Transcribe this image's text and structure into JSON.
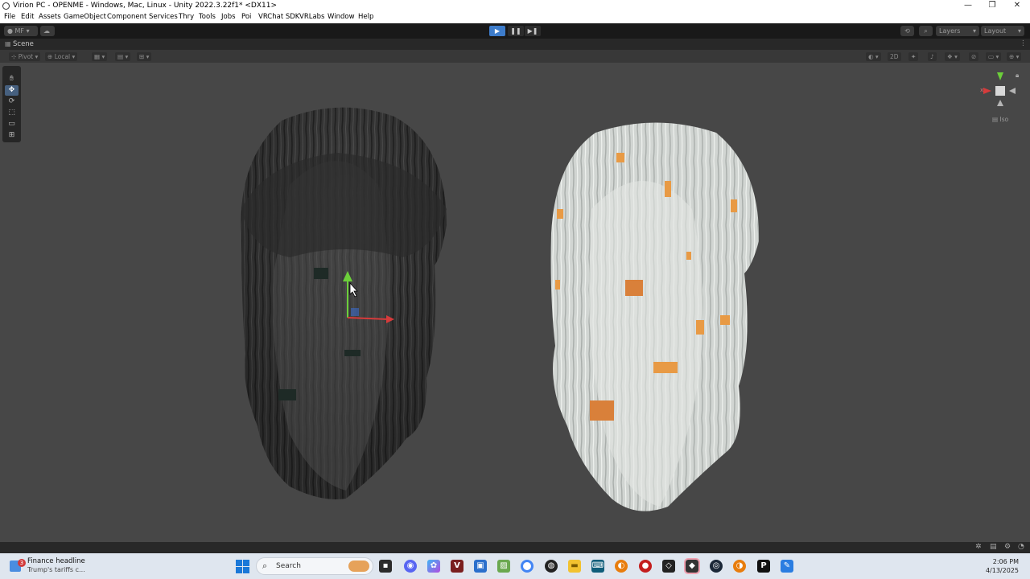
{
  "window": {
    "title": "Virion PC - OPENME - Windows, Mac, Linux - Unity 2022.3.22f1* <DX11>",
    "minimize": "—",
    "maximize": "❐",
    "close": "✕"
  },
  "menu": [
    "File",
    "Edit",
    "Assets",
    "GameObject",
    "Component",
    "Services",
    "Thry",
    "Tools",
    "Jobs",
    "Poi",
    "VRChat SDK",
    "VRLabs",
    "Window",
    "Help"
  ],
  "toolbar": {
    "account": "MF",
    "play": "▶",
    "pause": "❚❚",
    "step": "▶❚",
    "layers": "Layers",
    "layout": "Layout"
  },
  "scene": {
    "tab_label": "Scene",
    "pivot": "Pivot",
    "local": "Local",
    "mode_2d": "2D",
    "iso_label": "Iso",
    "gizmo_x": "x"
  },
  "tools": [
    "hand-tool",
    "move-tool",
    "rotate-tool",
    "scale-tool",
    "rect-tool",
    "transform-tool"
  ],
  "taskbar": {
    "news_title": "Finance headline",
    "news_body": "Trump's tariffs c...",
    "news_badge": "3",
    "search_placeholder": "Search",
    "time": "2:06 PM",
    "date": "4/13/2025"
  },
  "colors": {
    "unity_play_blue": "#3d7ccb",
    "scene_bg": "#474747",
    "gizmo_y": "#6ccf3a",
    "gizmo_x": "#d63b3b",
    "gizmo_z": "#3b6fd6"
  }
}
